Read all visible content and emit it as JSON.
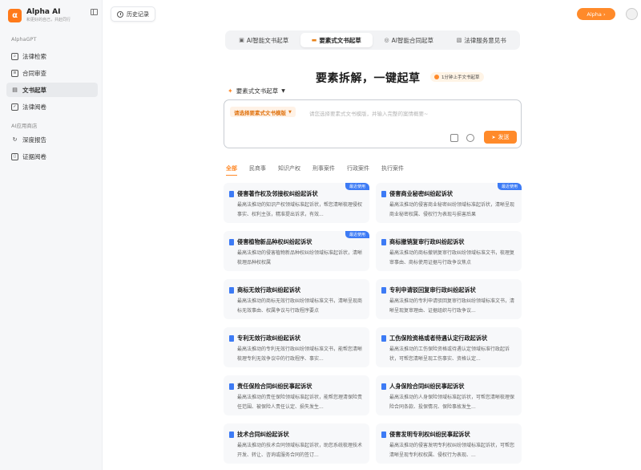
{
  "brand": {
    "name": "Alpha AI",
    "slogan": "和更好的自己，共赴同行",
    "logo_letter": "α"
  },
  "sidebar": {
    "section1": "AlphaGPT",
    "section2": "AI应用商店",
    "items": [
      {
        "label": "法律检索",
        "icon": "search-box-icon"
      },
      {
        "label": "合同审查",
        "icon": "contract-icon"
      },
      {
        "label": "文书起草",
        "icon": "document-icon",
        "active": true
      },
      {
        "label": "法律阅卷",
        "icon": "checkbox-icon"
      },
      {
        "label": "深度报告",
        "icon": "refresh-icon"
      },
      {
        "label": "证据阅卷",
        "icon": "evidence-icon"
      }
    ]
  },
  "header": {
    "history_label": "历史记录",
    "alpha_label": "Alpha ›"
  },
  "tabs": [
    {
      "label": "AI智能文书起草"
    },
    {
      "label": "要素式文书起草",
      "active": true
    },
    {
      "label": "AI智能合同起草"
    },
    {
      "label": "法律服务意见书"
    }
  ],
  "hero": {
    "title": "要素拆解，一键起草",
    "badge": "1分钟上手文书起草"
  },
  "mode_select": {
    "label": "要素式文书起草"
  },
  "composer": {
    "template_button": "请选择要素式文书模版",
    "placeholder": "请您选择要素式文书模版，并输入完整的案情概要~",
    "send_label": "发送"
  },
  "categories": [
    "全部",
    "民商事",
    "知识产权",
    "刑事案件",
    "行政案件",
    "执行案件"
  ],
  "cards": [
    {
      "title": "侵害著作权及邻接权纠纷起诉状",
      "desc": "最高法推动的知识产权领域标准起诉状，帮您清晰梳理侵权事实、权利主张，精准提出诉求，有效...",
      "tag": "最近使用"
    },
    {
      "title": "侵害商业秘密纠纷起诉状",
      "desc": "最高法推动的侵害商业秘密纠纷领域标准起诉状，清晰呈现商业秘密权属、侵权行为表现与损害后果",
      "tag": "最近使用"
    },
    {
      "title": "侵害植物新品种权纠纷起诉状",
      "desc": "最高法推动的侵害植物新品种权纠纷领域标准起诉状，清晰梳理品种权权属",
      "tag": "最近使用"
    },
    {
      "title": "商标撤销复审行政纠纷起诉状",
      "desc": "最高法推动的商标撤销复审行政纠纷领域标准文书，梳理复审事由、商标使用证据与行政争议焦点",
      "tag": ""
    },
    {
      "title": "商标无效行政纠纷起诉状",
      "desc": "最高法推动的商标无效行政纠纷领域标准文书，清晰呈现商标无效事由、权属争议与行政程序要点",
      "tag": ""
    },
    {
      "title": "专利申请驳回复审行政纠纷起诉状",
      "desc": "最高法推动的专利申请驳回复审行政纠纷领域标准文书，清晰呈现复审理由、证据组织与行政争议...",
      "tag": ""
    },
    {
      "title": "专利无效行政纠纷起诉状",
      "desc": "最高法推动的专利无效行政纠纷领域标准文书，能帮您清晰梳理专利无效争议中的行政程序、事实...",
      "tag": ""
    },
    {
      "title": "工伤保险资格或者待遇认定行政起诉状",
      "desc": "最高法推动的工伤保险资格或待遇认定领域标准行政起诉状，可帮您清晰呈现工伤事实、资格认定...",
      "tag": ""
    },
    {
      "title": "责任保险合同纠纷民事起诉状",
      "desc": "最高法推动的责任保险领域标准起诉状，能帮您理清保险责任范围、被保险人责任认定、损失发生...",
      "tag": ""
    },
    {
      "title": "人身保险合同纠纷民事起诉状",
      "desc": "最高法推动的人身保险领域标准起诉状，可帮您清晰梳理保险合同条款、投保情况、保险事故发生...",
      "tag": ""
    },
    {
      "title": "技术合同纠纷起诉状",
      "desc": "最高法推动的技术合同领域标准起诉状，助您系统梳理技术开发、转让、咨询或服务合同的签订...",
      "tag": ""
    },
    {
      "title": "侵害发明专利权纠纷民事起诉状",
      "desc": "最高法推动的侵害发明专利权纠纷领域标准起诉状，可帮您清晰呈现专利权权属、侵权行为表现、...",
      "tag": ""
    }
  ],
  "colors": {
    "accent": "#ff8a2a",
    "blue": "#3d7bf5"
  }
}
